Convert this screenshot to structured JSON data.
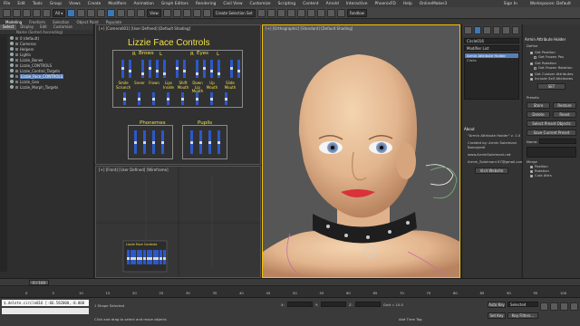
{
  "menubar": {
    "items": [
      "File",
      "Edit",
      "Tools",
      "Group",
      "Views",
      "Create",
      "Modifiers",
      "Animation",
      "Graph Editors",
      "Rendering",
      "Civil View",
      "Customize",
      "Scripting",
      "Content",
      "Arnold",
      "Interactive",
      "PhoenixFD",
      "Help",
      "OnlineMaker3"
    ],
    "sign_in": "Sign In",
    "workspaces": "Workspaces: Default"
  },
  "toolbar": {
    "view_select": "View",
    "selection_set": "Create Selection Set",
    "viewport_label": "Fandlow"
  },
  "ribbon": {
    "tabs": [
      "Modeling",
      "Freeform",
      "Selection",
      "Object Paint",
      "Populate"
    ]
  },
  "explorer": {
    "tabs": [
      "Select",
      "Display",
      "Edit",
      "Customize"
    ],
    "header": "Name (Sorted Ascending)",
    "items": [
      {
        "label": "0 (default)",
        "selected": false
      },
      {
        "label": "Cameras",
        "selected": false
      },
      {
        "label": "Helpers",
        "selected": false
      },
      {
        "label": "Lights",
        "selected": false
      },
      {
        "label": "Lizzie_Bones",
        "selected": false
      },
      {
        "label": "Lizzie_CONTROLS",
        "selected": false
      },
      {
        "label": "Lizzie_Control_Targets",
        "selected": false
      },
      {
        "label": "Lizzie_Face_CONTROLS",
        "selected": true
      },
      {
        "label": "Lizzie_Geo",
        "selected": false
      },
      {
        "label": "Lizzie_Morph_Targets",
        "selected": false
      }
    ]
  },
  "viewports": {
    "face_label": "[+] [Camera001] [User Defined] [Default Shading]",
    "front_label": "[+] [Front] [User Defined] [Wireframe]",
    "persp_label": "[+] [Orthographic] [Standard] [Default Shading]"
  },
  "face_controls": {
    "title": "Lizzie Face Controls",
    "brows": "Brows",
    "eyes": "Eyes",
    "r1": "R",
    "l1": "L",
    "r2": "R",
    "l2": "L",
    "labels": [
      "Smile Scrunch",
      "Sneer",
      "Frown",
      "Lips Inside",
      "Shift Mouth",
      "Down Lip Mouth",
      "Up Mouth",
      "Slide Mouth"
    ],
    "phonemes": "Phonemes",
    "pupils": "Pupils",
    "mini_title": "Lizzie Face Controls"
  },
  "command_panel": {
    "object_name": "Circle016",
    "modifier_list": "Modifier List",
    "stack": [
      "Armin Attribute Holder",
      "Circle"
    ],
    "about_header": "About",
    "about_lines": [
      "\"Armin Attribute Holder\" v. 1.0",
      "Created by: Armin Soleimani",
      "Boroujerdi",
      "www.ArminSoleimani.net",
      "Armin_Soleimani.97@gmail.com"
    ],
    "visit_button": "Visit Website"
  },
  "rollout": {
    "title": "Armin Attribute Holder",
    "define": "Define",
    "get_position": "Get Position",
    "get_frozen_pos": "Get Frozen Pos",
    "get_rotation": "Get Rotation",
    "get_frozen_rot": "Get Frozen Rotation",
    "get_custom": "Get Custom Attributes",
    "include_self": "Include Self Attributes",
    "set_button": "SET",
    "presets": "Presets",
    "store": "Store",
    "restore": "Restore",
    "delete": "Delete",
    "reset": "Reset",
    "select_preset": "Select Preset Objects",
    "save_current": "Save Current Preset",
    "name_label": "Name:",
    "merge_label": "Merge",
    "position": "Position",
    "rotation": "Rotation",
    "custom_attrs": "Cust Attrs"
  },
  "timeline": {
    "frame_display": "0 / 100",
    "ticks": [
      "0",
      "5",
      "10",
      "15",
      "20",
      "25",
      "30",
      "35",
      "40",
      "45",
      "50",
      "55",
      "60",
      "65",
      "70",
      "75",
      "80",
      "85",
      "90",
      "95",
      "100"
    ]
  },
  "status": {
    "maxscript": "$.delete.circle016 [-66.582000,-0.000",
    "shapes_selected": "1 Shape Selected",
    "prompt": "Click and drag to select and move objects",
    "x_label": "X:",
    "y_label": "Y:",
    "z_label": "Z:",
    "grid": "Grid = 10.0",
    "add_time_tag": "Add Time Tag",
    "auto_key": "Auto Key",
    "selected": "Selected",
    "set_key": "Set Key",
    "key_filters": "Key Filters..."
  }
}
